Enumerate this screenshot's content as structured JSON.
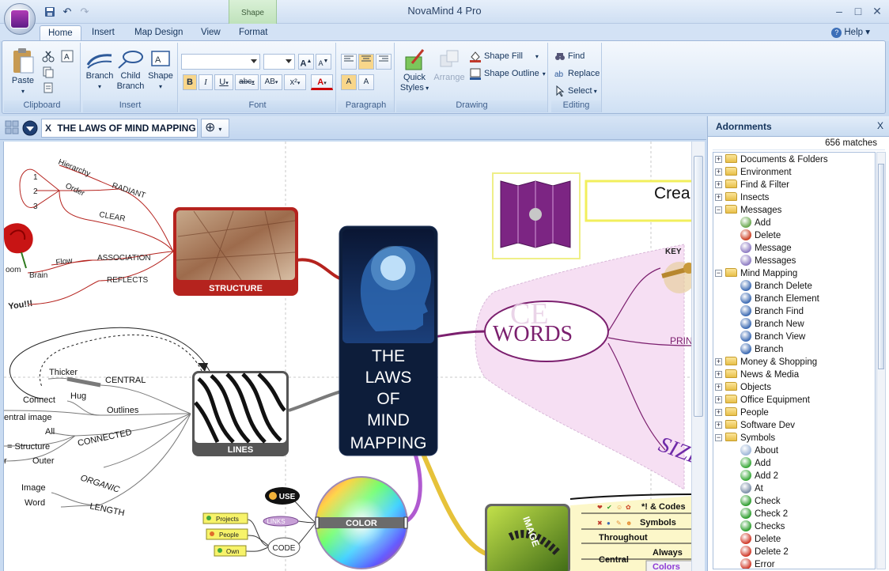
{
  "window": {
    "title": "NovaMind 4 Pro",
    "context_tab": "Shape",
    "controls": [
      "–",
      "□",
      "✕"
    ]
  },
  "ribbon_tabs": [
    {
      "label": "Home",
      "active": true
    },
    {
      "label": "Insert",
      "active": false
    },
    {
      "label": "Map Design",
      "active": false
    },
    {
      "label": "View",
      "active": false
    },
    {
      "label": "Format",
      "active": false
    }
  ],
  "help_label": "Help",
  "ribbon": {
    "clipboard": {
      "label": "Clipboard",
      "paste": "Paste"
    },
    "insert": {
      "label": "Insert",
      "branch": "Branch",
      "child_branch_1": "Child",
      "child_branch_2": "Branch",
      "shape": "Shape"
    },
    "font": {
      "label": "Font",
      "bold": "B",
      "italic": "I",
      "underline": "U",
      "strike": "abc",
      "spacing": "AB",
      "superscript": "x²",
      "color": "A",
      "grow": "A",
      "shrink": "A"
    },
    "paragraph": {
      "label": "Paragraph"
    },
    "drawing": {
      "label": "Drawing",
      "quick_styles_1": "Quick",
      "quick_styles_2": "Styles",
      "arrange": "Arrange",
      "shape_fill": "Shape Fill",
      "shape_outline": "Shape Outline"
    },
    "editing": {
      "label": "Editing",
      "find": "Find",
      "replace": "Replace",
      "select": "Select"
    }
  },
  "document": {
    "tab_title": "THE LAWS OF MIND MAPPING",
    "close": "X"
  },
  "mindmap": {
    "central_lines": [
      "THE",
      "LAWS",
      "OF",
      "MIND",
      "MAPPING"
    ],
    "structure": "STRUCTURE",
    "lines": "LINES",
    "color": "COLOR",
    "words_title": "WORDS",
    "image_label": "IMAGE",
    "top_right_text": "Crea",
    "key": "KEY",
    "prin": "PRIN",
    "size": "SIZE",
    "structure_branches": {
      "hierarchy": "Hierarchy",
      "order": "Order",
      "radiant": "RADIANT",
      "clear": "CLEAR",
      "association": "ASSOCIATION",
      "reflects": "REFLECTS",
      "flow": "Flow",
      "brain": "Brain",
      "oom": "oom",
      "you": "You!!!",
      "nums": [
        "1",
        "2",
        "3"
      ]
    },
    "lines_branches": {
      "thicker": "Thicker",
      "central": "CENTRAL",
      "connect": "Connect",
      "hug": "Hug",
      "outlines": "Outlines",
      "central_image": "entral image",
      "all": "All",
      "structure_eq": "= Structure",
      "r": "r",
      "outer": "Outer",
      "connected": "CONNECTED",
      "organic": "ORGANIC",
      "image": "Image",
      "word": "Word",
      "length": "LENGTH"
    },
    "color_branches": {
      "use": "USE",
      "links": "LINKS",
      "code": "CODE",
      "projects": "Projects",
      "people": "People",
      "own": "Own"
    },
    "image_branches": {
      "codes": "*! & Codes",
      "symbols": "Symbols",
      "throughout": "Throughout",
      "always": "Always",
      "central": "Central",
      "colors": "Colors"
    }
  },
  "adornments": {
    "title": "Adornments",
    "close": "X",
    "matches": "656 matches",
    "tree": [
      {
        "label": "Documents & Folders",
        "type": "folder",
        "expander": "+"
      },
      {
        "label": "Environment",
        "type": "folder",
        "expander": "+"
      },
      {
        "label": "Find & Filter",
        "type": "folder",
        "expander": "+"
      },
      {
        "label": "Insects",
        "type": "folder",
        "expander": "+"
      },
      {
        "label": "Messages",
        "type": "folder",
        "expander": "−"
      },
      {
        "label": "Add",
        "type": "leaf",
        "icon": "message-add-icon",
        "color": "#6aa84f"
      },
      {
        "label": "Delete",
        "type": "leaf",
        "icon": "message-delete-icon",
        "color": "#cc4125"
      },
      {
        "label": "Message",
        "type": "leaf",
        "icon": "message-icon",
        "color": "#8e7cc3"
      },
      {
        "label": "Messages",
        "type": "leaf",
        "icon": "messages-icon",
        "color": "#8e7cc3"
      },
      {
        "label": "Mind Mapping",
        "type": "folder",
        "expander": "−"
      },
      {
        "label": "Branch Delete",
        "type": "leaf",
        "icon": "branch-delete-icon",
        "color": "#3d6bb3"
      },
      {
        "label": "Branch Element",
        "type": "leaf",
        "icon": "branch-element-icon",
        "color": "#3d6bb3"
      },
      {
        "label": "Branch Find",
        "type": "leaf",
        "icon": "branch-find-icon",
        "color": "#3d6bb3"
      },
      {
        "label": "Branch New",
        "type": "leaf",
        "icon": "branch-new-icon",
        "color": "#3d6bb3"
      },
      {
        "label": "Branch View",
        "type": "leaf",
        "icon": "branch-view-icon",
        "color": "#3d6bb3"
      },
      {
        "label": "Branch",
        "type": "leaf",
        "icon": "branch-icon",
        "color": "#3d6bb3"
      },
      {
        "label": "Money & Shopping",
        "type": "folder",
        "expander": "+"
      },
      {
        "label": "News & Media",
        "type": "folder",
        "expander": "+"
      },
      {
        "label": "Objects",
        "type": "folder",
        "expander": "+"
      },
      {
        "label": "Office Equipment",
        "type": "folder",
        "expander": "+"
      },
      {
        "label": "People",
        "type": "folder",
        "expander": "+"
      },
      {
        "label": "Software Dev",
        "type": "folder",
        "expander": "+"
      },
      {
        "label": "Symbols",
        "type": "folder",
        "expander": "−"
      },
      {
        "label": "About",
        "type": "leaf",
        "icon": "about-icon",
        "color": "#9fb7d8"
      },
      {
        "label": "Add",
        "type": "leaf",
        "icon": "add-icon",
        "color": "#38a838"
      },
      {
        "label": "Add 2",
        "type": "leaf",
        "icon": "add-2-icon",
        "color": "#38a838"
      },
      {
        "label": "At",
        "type": "leaf",
        "icon": "at-icon",
        "color": "#7d8fa8"
      },
      {
        "label": "Check",
        "type": "leaf",
        "icon": "check-icon",
        "color": "#2f9e2f"
      },
      {
        "label": "Check 2",
        "type": "leaf",
        "icon": "check-2-icon",
        "color": "#2f9e2f"
      },
      {
        "label": "Checks",
        "type": "leaf",
        "icon": "checks-icon",
        "color": "#2f9e2f"
      },
      {
        "label": "Delete",
        "type": "leaf",
        "icon": "delete-icon",
        "color": "#d03a2a"
      },
      {
        "label": "Delete 2",
        "type": "leaf",
        "icon": "delete-2-icon",
        "color": "#d03a2a"
      },
      {
        "label": "Error",
        "type": "leaf",
        "icon": "error-icon",
        "color": "#d03a2a"
      }
    ]
  },
  "colors": {
    "ribbon_bg": "#dde9f7",
    "accent": "#15345c",
    "central_bg": "#0d1d3a",
    "structure_red": "#b5231e",
    "words_purple": "#7b1f6e"
  }
}
